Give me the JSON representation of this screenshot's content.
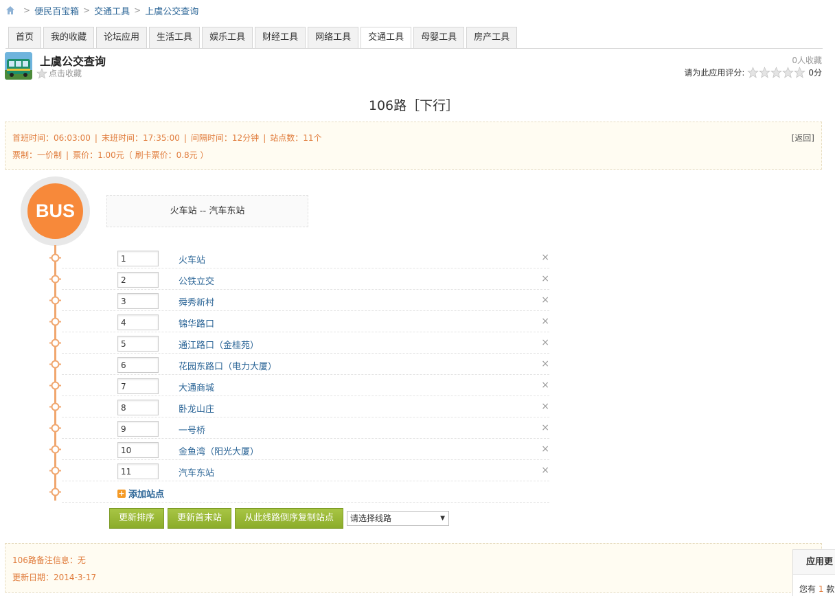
{
  "breadcrumb": {
    "items": [
      "便民百宝箱",
      "交通工具",
      "上虞公交查询"
    ]
  },
  "tabs": [
    "首页",
    "我的收藏",
    "论坛应用",
    "生活工具",
    "娱乐工具",
    "财经工具",
    "网络工具",
    "交通工具",
    "母婴工具",
    "房产工具"
  ],
  "active_tab": "交通工具",
  "app": {
    "title": "上虞公交查询",
    "fav_label": "点击收藏",
    "fav_count": "0人收藏",
    "rating_label": "请为此应用评分:",
    "rating_score": "0分",
    "rating_stars": 0
  },
  "route": {
    "title": "106路［下行］",
    "first_bus": "首班时间：06:03:00",
    "last_bus": "末班时间：17:35:00",
    "interval": "间隔时间：12分钟",
    "stop_count": "站点数：11个",
    "fare_type": "票制：一价制",
    "fare": "票价：1.00元（ 刷卡票价：0.8元 ）",
    "back_label": "[返回]",
    "badge": "BUS",
    "name": "火车站 -- 汽车东站"
  },
  "stops": [
    {
      "order": "1",
      "name": "火车站"
    },
    {
      "order": "2",
      "name": "公铁立交"
    },
    {
      "order": "3",
      "name": "舜秀新村"
    },
    {
      "order": "4",
      "name": "锦华路口"
    },
    {
      "order": "5",
      "name": "通江路口（金桂苑）"
    },
    {
      "order": "6",
      "name": "花园东路口（电力大厦）"
    },
    {
      "order": "7",
      "name": "大通商城"
    },
    {
      "order": "8",
      "name": "卧龙山庄"
    },
    {
      "order": "9",
      "name": "一号桥"
    },
    {
      "order": "10",
      "name": "金鱼湾（阳光大厦）"
    },
    {
      "order": "11",
      "name": "汽车东站"
    }
  ],
  "add_stop_label": "添加站点",
  "delete_glyph": "×",
  "buttons": {
    "update_order": "更新排序",
    "update_ends": "更新首末站",
    "copy_reverse": "从此线路倒序复制站点",
    "select_placeholder": "请选择线路"
  },
  "notes": {
    "remark": "106路备注信息：无",
    "updated": "更新日期：2014-3-17"
  },
  "side_panel": {
    "title": "应用更",
    "text_prefix": "您有",
    "count": "1",
    "text_suffix": "款"
  },
  "colors": {
    "accent_orange": "#f7893a",
    "timeline": "#f0a66e",
    "link_blue": "#2a6496",
    "button_green": "#8bac2a",
    "info_text": "#e07b3b"
  }
}
